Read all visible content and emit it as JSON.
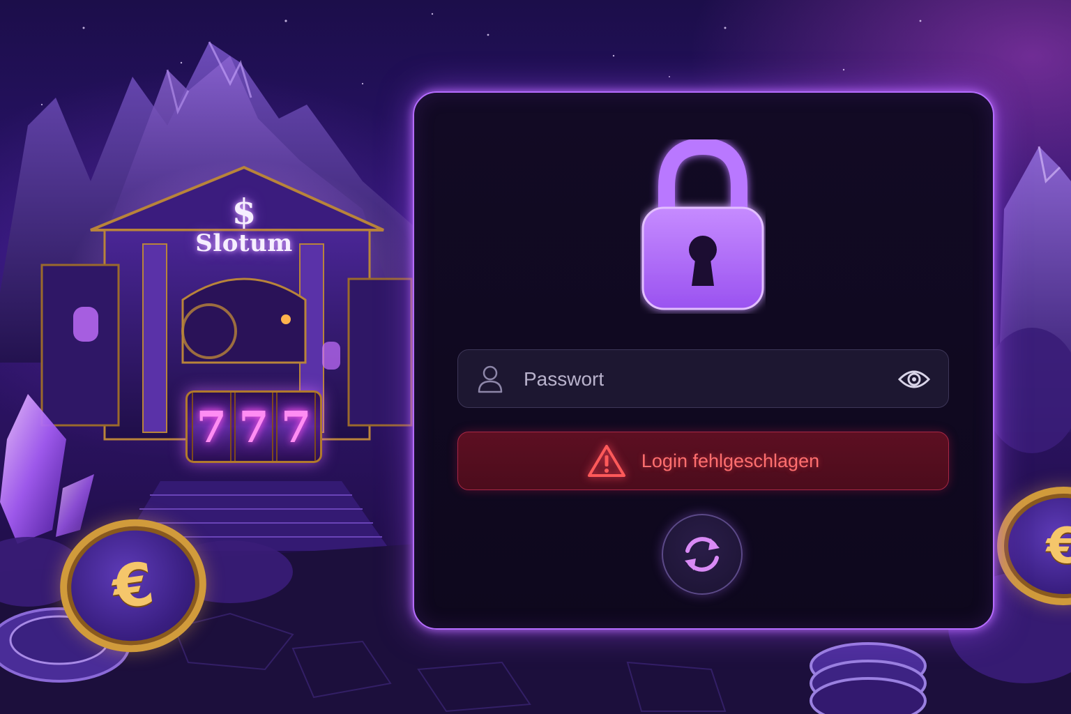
{
  "background": {
    "casino_sign": {
      "symbol": "$",
      "name": "Slotum"
    },
    "slot_reels": [
      "7",
      "7",
      "7"
    ],
    "coin_symbol": "€"
  },
  "login": {
    "lock_icon": "padlock-icon",
    "password_field": {
      "placeholder": "Passwort",
      "value": "",
      "leading_icon": "user-icon",
      "trailing_icon": "eye-icon"
    },
    "error": {
      "icon": "warning-triangle-icon",
      "message": "Login fehlgeschlagen"
    },
    "retry_button": {
      "icon": "refresh-icon"
    }
  },
  "colors": {
    "accent": "#b56cff",
    "card_background": "#0e081d",
    "error_background": "#5d0f22",
    "error_text": "#ff6f6f"
  }
}
